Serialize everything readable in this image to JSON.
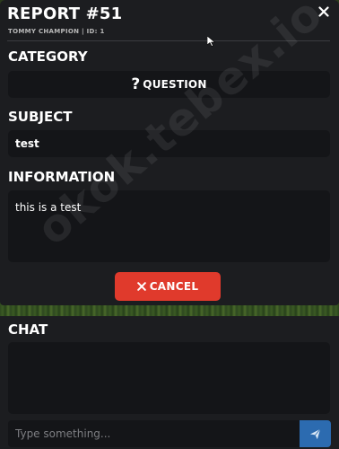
{
  "report": {
    "title": "REPORT #51",
    "subtitle": "TOMMY CHAMPION | ID: 1"
  },
  "icons": {
    "close": "close-icon",
    "question": "question-icon",
    "cancel": "x-icon",
    "send": "send-icon"
  },
  "category": {
    "label": "CATEGORY",
    "glyph": "?",
    "value": "QUESTION"
  },
  "subject": {
    "label": "SUBJECT",
    "value": "test"
  },
  "information": {
    "label": "INFORMATION",
    "value": "this is a test"
  },
  "cancel_button": {
    "label": "CANCEL"
  },
  "chat": {
    "label": "CHAT",
    "placeholder": "Type something..."
  },
  "watermark": "okok.tebex.io",
  "colors": {
    "panel": "#1c1d20",
    "field": "#141518",
    "cancel": "#e03a2c",
    "send": "#2c6bb0"
  }
}
